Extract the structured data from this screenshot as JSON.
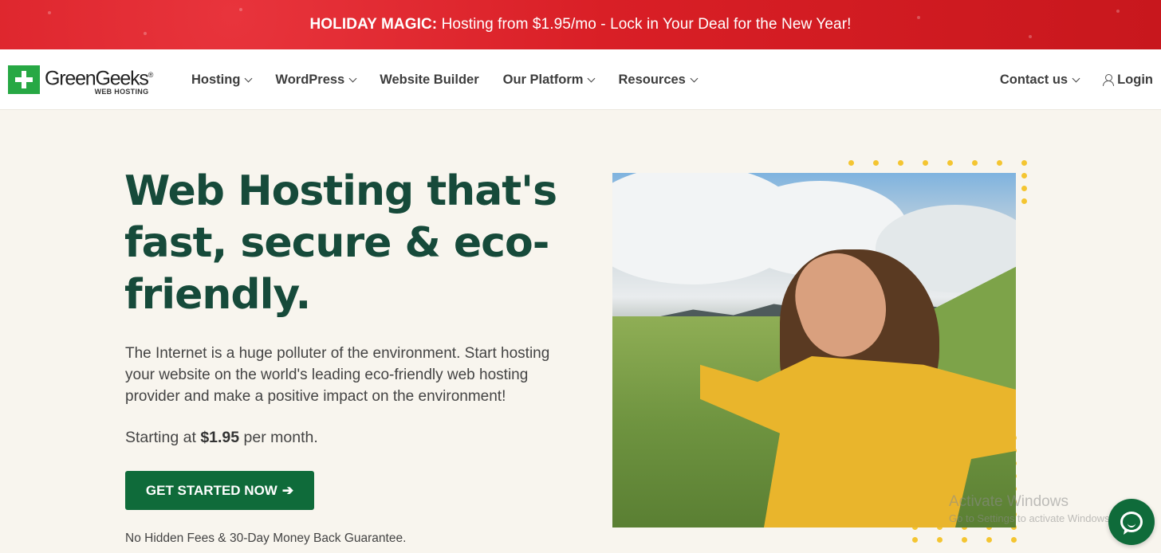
{
  "promo": {
    "strong": "HOLIDAY MAGIC:",
    "text": " Hosting from $1.95/mo - Lock in Your Deal for the New Year!"
  },
  "logo": {
    "name": "GreenGeeks",
    "registered": "®",
    "sub": "WEB HOSTING",
    "icon": "green-plus-logo-icon"
  },
  "nav": {
    "items": [
      {
        "label": "Hosting",
        "dropdown": true
      },
      {
        "label": "WordPress",
        "dropdown": true
      },
      {
        "label": "Website Builder",
        "dropdown": false
      },
      {
        "label": "Our Platform",
        "dropdown": true
      },
      {
        "label": "Resources",
        "dropdown": true
      }
    ],
    "contact": "Contact us",
    "login": "Login"
  },
  "hero": {
    "title_line1": "Web Hosting that's",
    "title_line2": "fast, secure & eco-",
    "title_line3": "friendly.",
    "description": "The Internet is a huge polluter of the environment. Start hosting your website on the world's leading eco-friendly web hosting provider and make a positive impact on the environment!",
    "price_prefix": "Starting at ",
    "price_value": "$1.95",
    "price_suffix": " per month.",
    "cta_label": "GET STARTED NOW",
    "cta_arrow": "➔",
    "guarantee": "No Hidden Fees & 30-Day Money Back Guarantee."
  },
  "watermark": {
    "title": "Activate Windows",
    "subtitle": "Go to Settings to activate Windows."
  },
  "colors": {
    "promo_red": "#d91f26",
    "brand_green": "#27a844",
    "heading_green": "#164a3a",
    "cta_green": "#0f6b3a",
    "accent_yellow": "#f4c531",
    "background": "#f8f5ee"
  },
  "icons": {
    "chat": "chat-bubble-icon",
    "user": "user-icon",
    "chevron": "chevron-down-icon"
  }
}
